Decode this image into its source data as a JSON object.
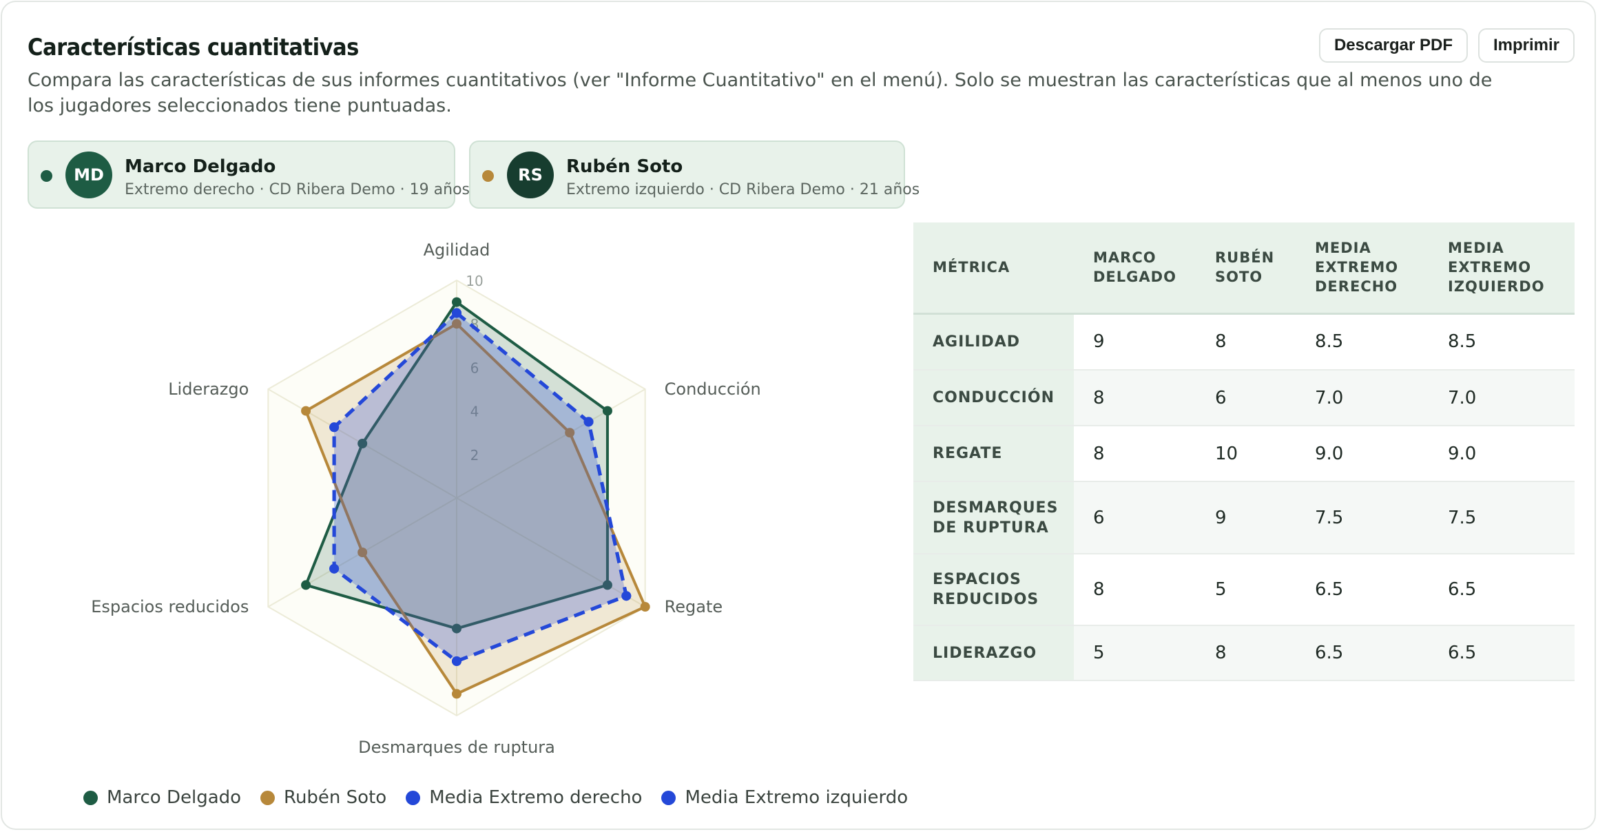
{
  "header": {
    "title": "Características cuantitativas",
    "description": "Compara las características de sus informes cuantitativos (ver \"Informe Cuantitativo\" en el menú). Solo se muestran las características que al menos uno de los jugadores seleccionados tiene puntuadas.",
    "download_pdf_label": "Descargar PDF",
    "print_label": "Imprimir"
  },
  "players": [
    {
      "initials": "MD",
      "name": "Marco Delgado",
      "meta": "Extremo derecho · CD Ribera Demo · 19 años",
      "color": "#1e5c44"
    },
    {
      "initials": "RS",
      "name": "Rubén Soto",
      "meta": "Extremo izquierdo · CD Ribera Demo · 21 años",
      "color": "#b7883a"
    }
  ],
  "colors": {
    "marco": "#1e5c44",
    "ruben": "#b7883a",
    "media": "#2448d8",
    "avatar_md": "#1e5c44",
    "avatar_rs": "#173d2f"
  },
  "chart_data": {
    "type": "radar",
    "axes": [
      "Agilidad",
      "Conducción",
      "Regate",
      "Desmarques de ruptura",
      "Espacios reducidos",
      "Liderazgo"
    ],
    "ticks": [
      "2",
      "4",
      "6",
      "8",
      "10"
    ],
    "rmax": 10,
    "series": [
      {
        "name": "Marco Delgado",
        "values": [
          9,
          8,
          8,
          6,
          8,
          5
        ],
        "color": "#1e5c44",
        "style": "solid"
      },
      {
        "name": "Rubén Soto",
        "values": [
          8,
          6,
          10,
          9,
          5,
          8
        ],
        "color": "#b7883a",
        "style": "solid"
      },
      {
        "name": "Media Extremo derecho",
        "values": [
          8.5,
          7.0,
          9.0,
          7.5,
          6.5,
          6.5
        ],
        "color": "#2448d8",
        "style": "dashed"
      },
      {
        "name": "Media Extremo izquierdo",
        "values": [
          8.5,
          7.0,
          9.0,
          7.5,
          6.5,
          6.5
        ],
        "color": "#2448d8",
        "style": "dashed"
      }
    ]
  },
  "table": {
    "headers": [
      "MÉTRICA",
      "MARCO DELGADO",
      "RUBÉN SOTO",
      "MEDIA EXTREMO DERECHO",
      "MEDIA EXTREMO IZQUIERDO"
    ],
    "rows": [
      [
        "AGILIDAD",
        "9",
        "8",
        "8.5",
        "8.5"
      ],
      [
        "CONDUCCIÓN",
        "8",
        "6",
        "7.0",
        "7.0"
      ],
      [
        "REGATE",
        "8",
        "10",
        "9.0",
        "9.0"
      ],
      [
        "DESMARQUES DE RUPTURA",
        "6",
        "9",
        "7.5",
        "7.5"
      ],
      [
        "ESPACIOS REDUCIDOS",
        "8",
        "5",
        "6.5",
        "6.5"
      ],
      [
        "LIDERAZGO",
        "5",
        "8",
        "6.5",
        "6.5"
      ]
    ]
  }
}
